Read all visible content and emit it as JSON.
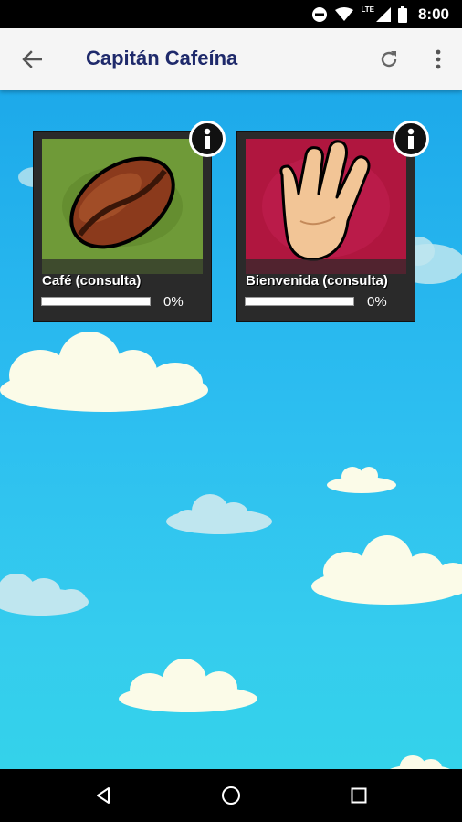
{
  "status_bar": {
    "time": "8:00",
    "network_label": "LTE",
    "icons": [
      "do-not-disturb-icon",
      "wifi-icon",
      "signal-icon",
      "battery-icon"
    ]
  },
  "app_bar": {
    "title": "Capitán Cafeína",
    "background": "#f5f5f5",
    "title_color": "#1f2a6b",
    "icons": [
      "back-arrow-icon",
      "refresh-icon",
      "more-vert-icon"
    ]
  },
  "cards": [
    {
      "label": "Café (consulta)",
      "progress_percent": 0,
      "progress_text": "0%",
      "image": "coffee-bean-image",
      "background": "#6f9a38"
    },
    {
      "label": "Bienvenida (consulta)",
      "progress_percent": 0,
      "progress_text": "0%",
      "image": "waving-hand-image",
      "background": "#b0163f"
    }
  ],
  "nav_bar": {
    "icons": [
      "nav-back-icon",
      "nav-home-icon",
      "nav-recents-icon"
    ]
  },
  "colors": {
    "sky_top": "#1da9ea",
    "sky_bottom": "#34d2ea",
    "cloud": "#fbfbe8",
    "cloud_faint": "#bfe6ef"
  }
}
